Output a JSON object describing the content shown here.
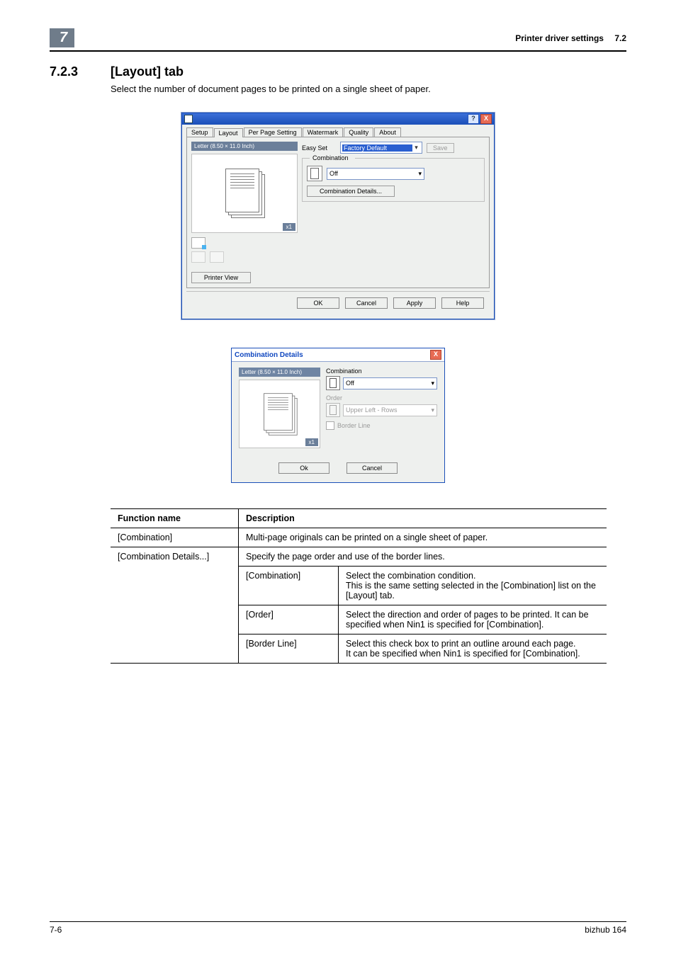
{
  "header": {
    "chapter": "7",
    "title": "Printer driver settings",
    "sec": "7.2"
  },
  "section": {
    "number": "7.2.3",
    "title": "[Layout] tab",
    "intro": "Select the number of document pages to be printed on a single sheet of paper."
  },
  "dlg1": {
    "tabs": [
      "Setup",
      "Layout",
      "Per Page Setting",
      "Watermark",
      "Quality",
      "About"
    ],
    "active_tab": 1,
    "paper_label": "Letter (8.50 × 11.0 Inch)",
    "x1": "x1",
    "printer_view": "Printer View",
    "easyset_label": "Easy Set",
    "easyset_value": "Factory Default",
    "save": "Save",
    "group_title": "Combination",
    "combo_value": "Off",
    "details_btn": "Combination Details...",
    "buttons": [
      "OK",
      "Cancel",
      "Apply",
      "Help"
    ],
    "help_icon": "?",
    "close_icon": "X"
  },
  "dlg2": {
    "title": "Combination Details",
    "close_icon": "X",
    "paper_label": "Letter (8.50 × 11.0 Inch)",
    "x1": "x1",
    "labels": {
      "combination": "Combination",
      "order": "Order",
      "border": "Border Line"
    },
    "combo_value": "Off",
    "order_value": "Upper Left - Rows",
    "buttons": [
      "Ok",
      "Cancel"
    ]
  },
  "table": {
    "head": [
      "Function name",
      "Description"
    ],
    "rows": {
      "combination": {
        "name": "[Combination]",
        "desc": "Multi-page originals can be printed on a single sheet of paper."
      },
      "details": {
        "name": "[Combination Details...]",
        "summary": "Specify the page order and use of the border lines.",
        "sub": [
          {
            "name": "[Combination]",
            "desc": "Select the combination condition.\nThis is the same setting selected in the [Combination] list on the [Layout] tab."
          },
          {
            "name": "[Order]",
            "desc": "Select the direction and order of pages to be printed. It can be specified when Nin1 is specified for [Combination]."
          },
          {
            "name": "[Border Line]",
            "desc": "Select this check box to print an outline around each page.\nIt can be specified when Nin1 is specified for [Combination]."
          }
        ]
      }
    }
  },
  "footer": {
    "left": "7-6",
    "right": "bizhub 164"
  }
}
